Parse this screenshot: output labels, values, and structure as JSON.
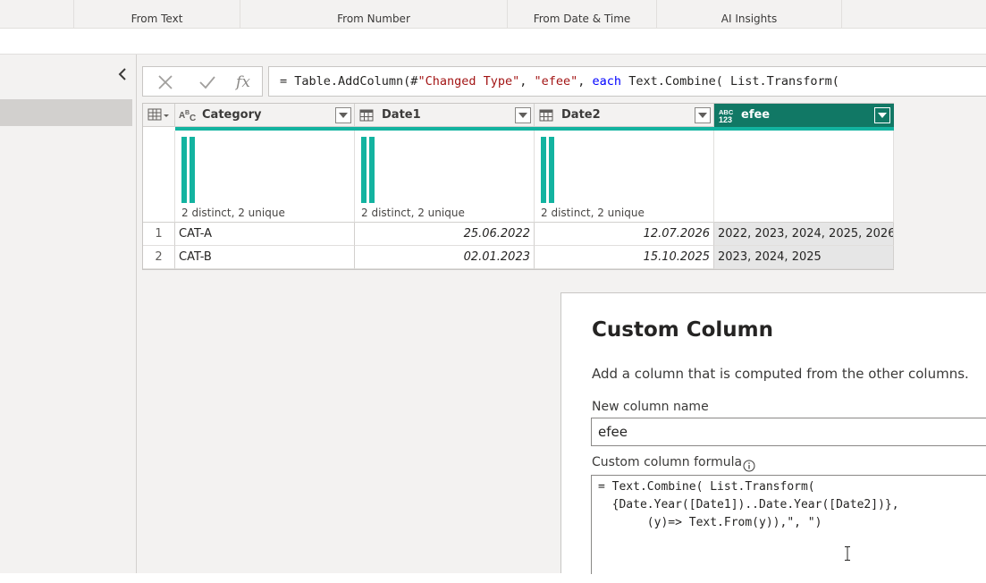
{
  "ribbon": {
    "groups": [
      {
        "label": "From Text"
      },
      {
        "label": "From Number"
      },
      {
        "label": "From Date & Time"
      },
      {
        "label": "AI Insights"
      }
    ]
  },
  "formula_bar": {
    "cancel_icon": "x-icon",
    "commit_icon": "check-icon",
    "fx_label": "fx",
    "parts": [
      "= Table.AddColumn(#",
      "\"Changed Type\"",
      ", ",
      "\"efee\"",
      ", ",
      "each",
      " Text.Combine( List.Transform("
    ]
  },
  "grid": {
    "columns": [
      {
        "name": "Category",
        "type": "ABC",
        "type_icon": "text-type-icon",
        "stat": "2 distinct, 2 unique"
      },
      {
        "name": "Date1",
        "type": "date",
        "type_icon": "calendar-type-icon",
        "stat": "2 distinct, 2 unique"
      },
      {
        "name": "Date2",
        "type": "date",
        "type_icon": "calendar-type-icon",
        "stat": "2 distinct, 2 unique"
      },
      {
        "name": "efee",
        "type": "ABC 123",
        "type_icon": "any-type-icon",
        "stat": ""
      }
    ],
    "rows": [
      {
        "num": "1",
        "cells": [
          "CAT-A",
          "25.06.2022",
          "12.07.2026",
          "2022, 2023, 2024, 2025, 2026"
        ]
      },
      {
        "num": "2",
        "cells": [
          "CAT-B",
          "02.01.2023",
          "15.10.2025",
          "2023, 2024, 2025"
        ]
      }
    ],
    "colors": {
      "quality_bar": "#13b3a0",
      "active_header": "#117865"
    }
  },
  "dialog": {
    "title": "Custom Column",
    "description": "Add a column that is computed from the other columns.",
    "name_label": "New column name",
    "name_value": "efee",
    "formula_label": "Custom column formula",
    "formula_lines": [
      "= Text.Combine( List.Transform(",
      "  {Date.Year([Date1])..Date.Year([Date2])},",
      "       (y)=> Text.From(y)),\", \")"
    ]
  }
}
